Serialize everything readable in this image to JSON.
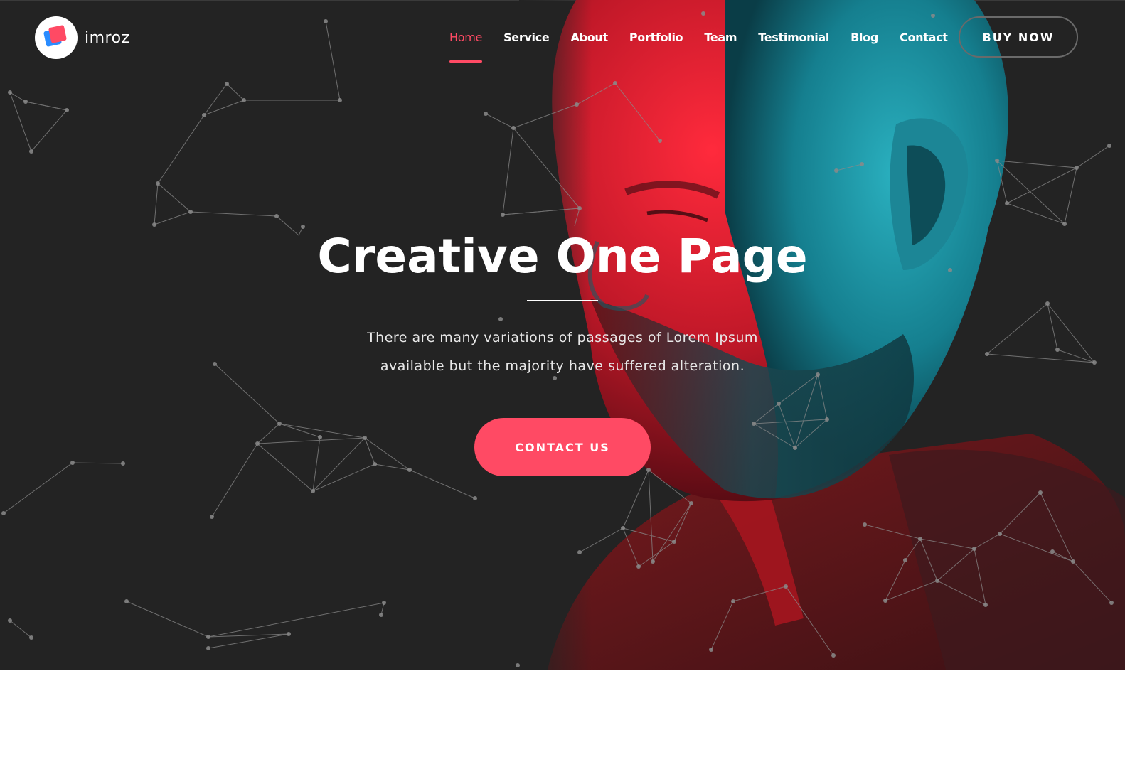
{
  "brand": {
    "name": "imroz",
    "logo_icon": "layered-squares-logo-icon",
    "colors": {
      "logo_red": "#ff4a64",
      "logo_blue": "#2a8cff"
    }
  },
  "nav": {
    "items": [
      {
        "label": "Home",
        "active": true
      },
      {
        "label": "Service",
        "active": false
      },
      {
        "label": "About",
        "active": false
      },
      {
        "label": "Portfolio",
        "active": false
      },
      {
        "label": "Team",
        "active": false
      },
      {
        "label": "Testimonial",
        "active": false
      },
      {
        "label": "Blog",
        "active": false
      },
      {
        "label": "Contact",
        "active": false
      }
    ],
    "buy_label": "BUY NOW"
  },
  "hero": {
    "title": "Creative One Page",
    "description_line1": "There are many variations of passages of Lorem Ipsum",
    "description_line2": "available but the majority have suffered alteration.",
    "cta_label": "CONTACT US",
    "background_image": "bald-bearded-man-red-cyan-lit-portrait",
    "overlay": "particle-network-lines"
  },
  "theme": {
    "background": "#232323",
    "accent": "#ff4a64",
    "text": "#ffffff"
  }
}
